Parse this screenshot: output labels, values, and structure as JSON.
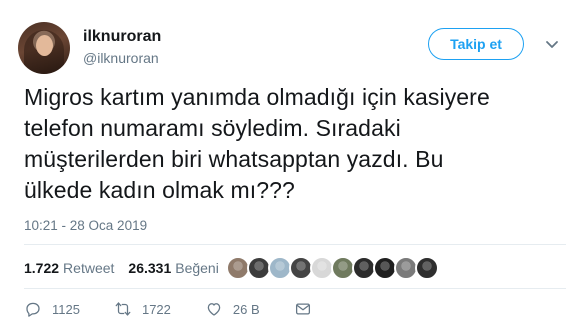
{
  "user": {
    "display_name": "ilknuroran",
    "handle": "@ilknuroran"
  },
  "follow_button": {
    "label": "Takip et"
  },
  "tweet": {
    "lines": [
      "Migros kartım yanımda olmadığı için kasiyere",
      "telefon numaramı söyledim. Sıradaki",
      "müşterilerden biri whatsapptan yazdı. Bu",
      "ülkede kadın olmak mı???"
    ],
    "timestamp": "10:21 - 28 Oca 2019"
  },
  "stats": {
    "retweets_count": "1.722",
    "retweets_label": "Retweet",
    "likes_count": "26.331",
    "likes_label": "Beğeni"
  },
  "liker_avatars": [
    "#8f7a6a",
    "#3c3c3c",
    "#9eb7c9",
    "#444444",
    "#d8d8d8",
    "#6f7a5e",
    "#2b2b2b",
    "#1f1f1f",
    "#7a7a7a",
    "#2e2e2e"
  ],
  "actions": {
    "reply_count": "1125",
    "retweet_count": "1722",
    "like_count": "26 B"
  },
  "colors": {
    "accent": "#1da1f2",
    "secondary_text": "#657786",
    "primary_text": "#14171a"
  }
}
